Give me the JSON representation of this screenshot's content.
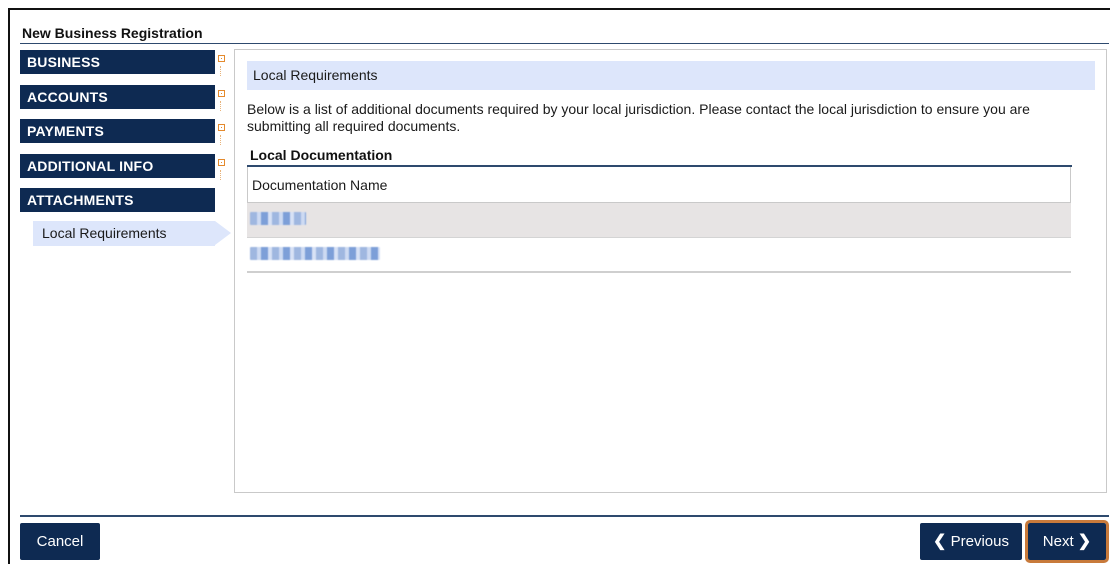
{
  "page": {
    "title": "New Business Registration"
  },
  "nav": {
    "items": [
      {
        "label": "BUSINESS"
      },
      {
        "label": "ACCOUNTS"
      },
      {
        "label": "PAYMENTS"
      },
      {
        "label": "ADDITIONAL INFO"
      },
      {
        "label": "ATTACHMENTS"
      }
    ],
    "sub_item": {
      "label": "Local Requirements"
    }
  },
  "content": {
    "section_header": "Local Requirements",
    "description": "Below is a list of additional documents required by your local jurisdiction. Please contact the local jurisdiction to ensure you are submitting all required documents.",
    "table_title": "Local Documentation",
    "column_header": "Documentation Name",
    "rows": [
      {
        "name": ""
      },
      {
        "name": ""
      }
    ]
  },
  "footer": {
    "cancel_label": "Cancel",
    "previous_label": "Previous",
    "next_label": "Next"
  },
  "icons": {
    "nav_marker": "expand-marker-icon",
    "prev": "chevron-left-icon",
    "next": "chevron-right-icon"
  },
  "colors": {
    "nav_bg": "#0e2a52",
    "highlight_bg": "#dde6fb",
    "accent_outline": "#c87a3b",
    "marker": "#e48a2d"
  }
}
